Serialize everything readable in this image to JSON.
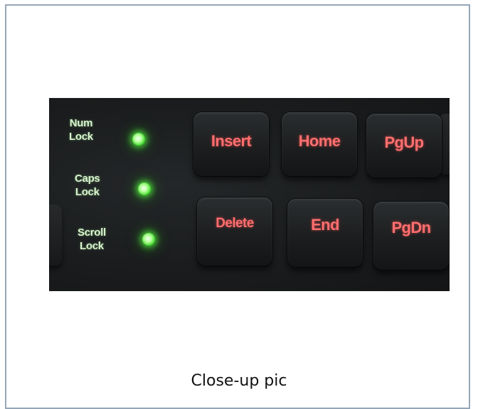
{
  "photo": {
    "led_indicators": [
      {
        "label_line1": "Num",
        "label_line2": "Lock"
      },
      {
        "label_line1": "Caps",
        "label_line2": "Lock"
      },
      {
        "label_line1": "Scroll",
        "label_line2": "Lock"
      }
    ],
    "keys_top_row": [
      "Insert",
      "Home",
      "PgUp"
    ],
    "keys_bottom_row": [
      "Delete",
      "End",
      "PgDn"
    ],
    "led_color": "#4be03a",
    "key_legend_color": "#ff6f6f",
    "background_color": "#1a1c1d"
  },
  "caption": "Close-up pic"
}
